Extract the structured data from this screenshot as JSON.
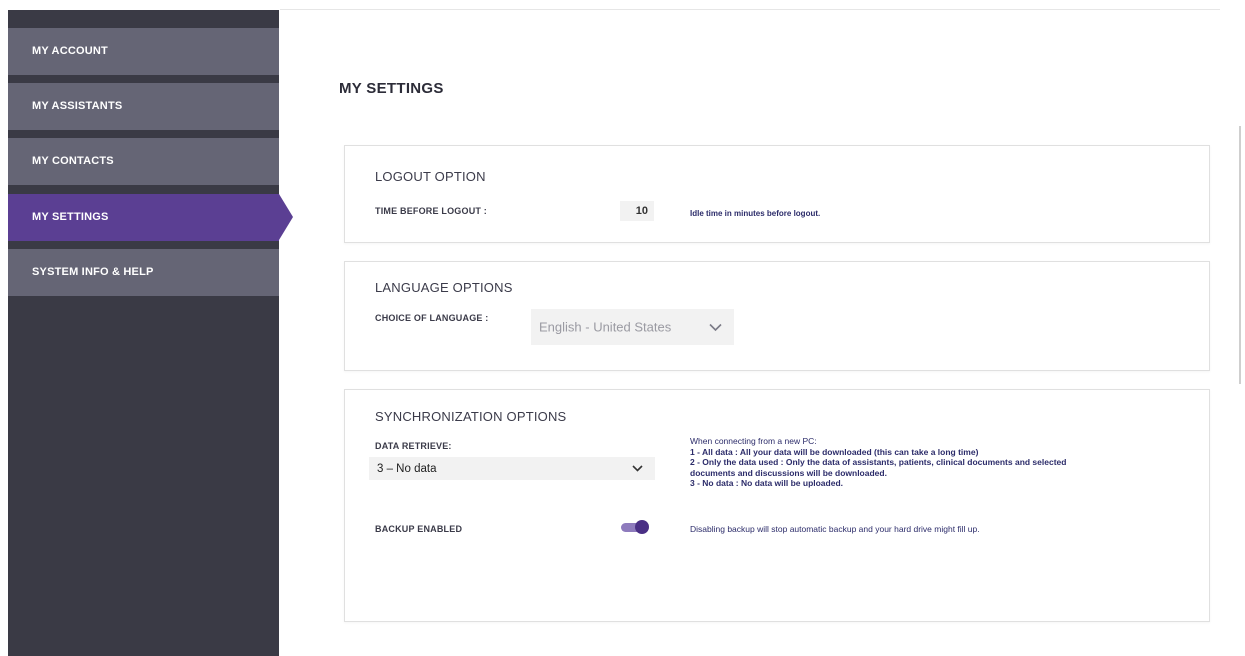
{
  "sidebar": {
    "items": [
      {
        "label": "MY ACCOUNT"
      },
      {
        "label": "MY ASSISTANTS"
      },
      {
        "label": "MY CONTACTS"
      },
      {
        "label": "MY SETTINGS"
      },
      {
        "label": "SYSTEM INFO & HELP"
      }
    ],
    "active_index": 3
  },
  "page": {
    "title": "MY SETTINGS"
  },
  "logout": {
    "title": "LOGOUT OPTION",
    "label": "TIME BEFORE LOGOUT :",
    "value": "10",
    "hint": "Idle time in minutes before logout."
  },
  "language": {
    "title": "LANGUAGE OPTIONS",
    "label": "CHOICE OF LANGUAGE :",
    "selected": "English - United States"
  },
  "sync": {
    "title": "SYNCHRONIZATION OPTIONS",
    "retrieve_label": "DATA RETRIEVE:",
    "retrieve_selected": "3 – No data",
    "help_intro": "When connecting from a new PC:",
    "help_lines": [
      "1 - All data : All your data will be downloaded (this can take a long time)",
      "2 - Only the data used : Only the data of assistants, patients, clinical documents and selected documents and discussions will be downloaded.",
      "3 - No data : No data will be uploaded."
    ],
    "backup_label": "BACKUP ENABLED",
    "backup_enabled": true,
    "backup_hint": "Disabling backup will stop automatic backup and your hard drive might fill up."
  },
  "colors": {
    "sidebar_bg": "#3a3a45",
    "nav_item_bg": "#656575",
    "active": "#5b3f93",
    "toggle_on": "#4a2f85"
  }
}
